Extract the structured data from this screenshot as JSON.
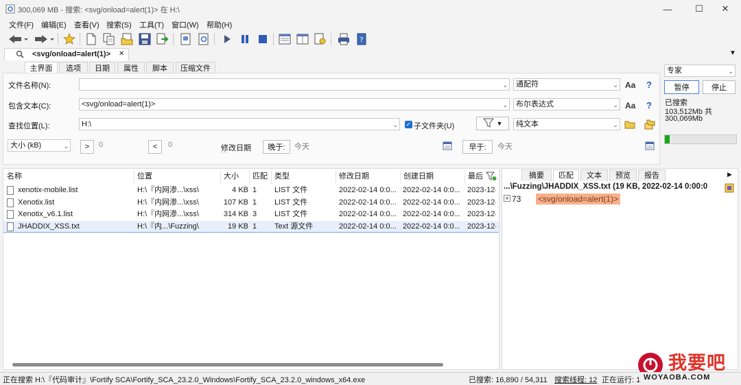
{
  "window": {
    "title": "300,069 MB - 搜索: <svg/onload=alert(1)> 在 H:\\",
    "minimize_glyph": "—",
    "maximize_glyph": "☐",
    "close_glyph": "✕"
  },
  "menu": [
    "文件(F)",
    "编辑(E)",
    "查看(V)",
    "搜索(S)",
    "工具(T)",
    "窗口(W)",
    "帮助(H)"
  ],
  "search_tab": {
    "label": "<svg/onload=alert(1)>",
    "close": "✕",
    "icon": "search-icon"
  },
  "tab_overflow_arrow": "▼",
  "option_tabs": [
    "主界面",
    "选项",
    "日期",
    "属性",
    "脚本",
    "压缩文件"
  ],
  "form": {
    "filename_label": "文件名称(N):",
    "filename_value": "",
    "filename_mode": "通配符",
    "content_label": "包含文本(C):",
    "content_value": "<svg/onload=alert(1)>",
    "content_mode": "布尔表达式",
    "location_label": "查找位置(L):",
    "location_value": "H:\\",
    "subfolder_label": "子文件夹(U)",
    "subfolder_checked": true,
    "location_mode": "纯文本",
    "size_unit": "大小 (kB)",
    "gt_btn": ">",
    "gt_value": "0",
    "lt_btn": "<",
    "lt_value": "0",
    "mdate_label": "修改日期",
    "mdate_sub": "- -",
    "later_btn": "晚于:",
    "later_value": "今天",
    "earlier_btn": "早于:",
    "earlier_value": "今天",
    "case_label": "Aa",
    "help_label": "?"
  },
  "right_panel": {
    "profile": "专家",
    "pause_btn": "暂停",
    "stop_btn": "停止",
    "searched_label": "已搜索",
    "searched_amount": "103,512Mb 共",
    "total_amount": "300,069Mb",
    "progress": 0.07,
    "accent": "#18a81e"
  },
  "results": {
    "columns": [
      "名称",
      "位置",
      "大小",
      "匹配",
      "类型",
      "修改日期",
      "创建日期",
      "最后"
    ],
    "rows": [
      {
        "name": "xenotix-mobile.list",
        "loc": "H:\\『内网渗...\\xss\\",
        "size": "4 KB",
        "match": "1",
        "type": "LIST 文件",
        "mdate": "2022-02-14 0:0...",
        "cdate": "2022-02-14 0:0...",
        "last": "2023-12-..."
      },
      {
        "name": "Xenotix.list",
        "loc": "H:\\『内网渗...\\xss\\",
        "size": "107 KB",
        "match": "1",
        "type": "LIST 文件",
        "mdate": "2022-02-14 0:0...",
        "cdate": "2022-02-14 0:0...",
        "last": "2023-12-..."
      },
      {
        "name": "Xenotix_v6.1.list",
        "loc": "H:\\『内网渗...\\xss\\",
        "size": "314 KB",
        "match": "3",
        "type": "LIST 文件",
        "mdate": "2022-02-14 0:0...",
        "cdate": "2022-02-14 0:0...",
        "last": "2023-12-..."
      },
      {
        "name": "JHADDIX_XSS.txt",
        "loc": "H:\\『内...\\Fuzzing\\",
        "size": "19 KB",
        "match": "1",
        "type": "Text 源文件",
        "mdate": "2022-02-14 0:0...",
        "cdate": "2022-02-14 0:0...",
        "last": "2023-12-..."
      }
    ]
  },
  "preview": {
    "tabs": [
      "摘要",
      "匹配",
      "文本",
      "预览",
      "报告"
    ],
    "active_tab": 1,
    "header": "...\\Fuzzing\\JHADDIX_XSS.txt   (19 KB,  2022-02-14 0:00:0",
    "line_no": "73",
    "expand": "+",
    "match_text": "<svg/onload=alert(1)>",
    "highlight": "#f7b08a"
  },
  "status": {
    "searching": "正在搜索 H:\\『代码审计』\\Fortify SCA\\Fortify_SCA_23.2.0_Windows\\Fortify_SCA_23.2.0_windows_x64.exe",
    "searched": "已搜索: 16,890 / 54,311",
    "threads": "搜索线程: 12",
    "running": "正在运行: 1"
  },
  "watermark": {
    "text": "我要吧",
    "sub": "WOYAOBA.COM"
  }
}
